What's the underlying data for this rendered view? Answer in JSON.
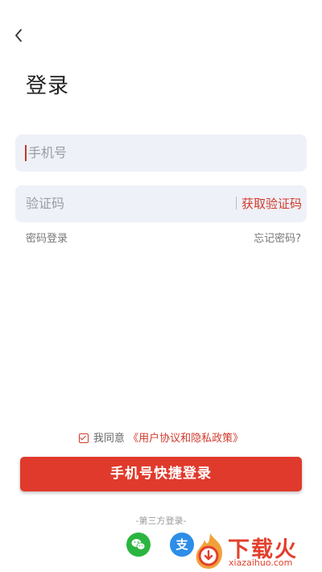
{
  "header": {
    "back_icon": "chevron-left-icon",
    "title": "登录"
  },
  "form": {
    "phone_placeholder": "手机号",
    "code_placeholder": "验证码",
    "get_code_label": "获取验证码"
  },
  "links": {
    "password_login": "密码登录",
    "forgot_password": "忘记密码?"
  },
  "agreement": {
    "checked": true,
    "prefix": "我同意",
    "policy": "《用户协议和隐私政策》"
  },
  "main_button": {
    "label": "手机号快捷登录"
  },
  "third_party": {
    "label": "-第三方登录-",
    "providers": [
      {
        "name": "wechat",
        "icon": "wechat-icon",
        "color": "#2bb540"
      },
      {
        "name": "alipay",
        "icon": "alipay-icon",
        "glyph": "支",
        "color": "#2d8ee8"
      }
    ]
  },
  "watermark": {
    "text": "下载火",
    "domain": "xiazaihuo.com"
  },
  "colors": {
    "accent": "#e03a2c",
    "field_bg": "#eef1f7"
  }
}
